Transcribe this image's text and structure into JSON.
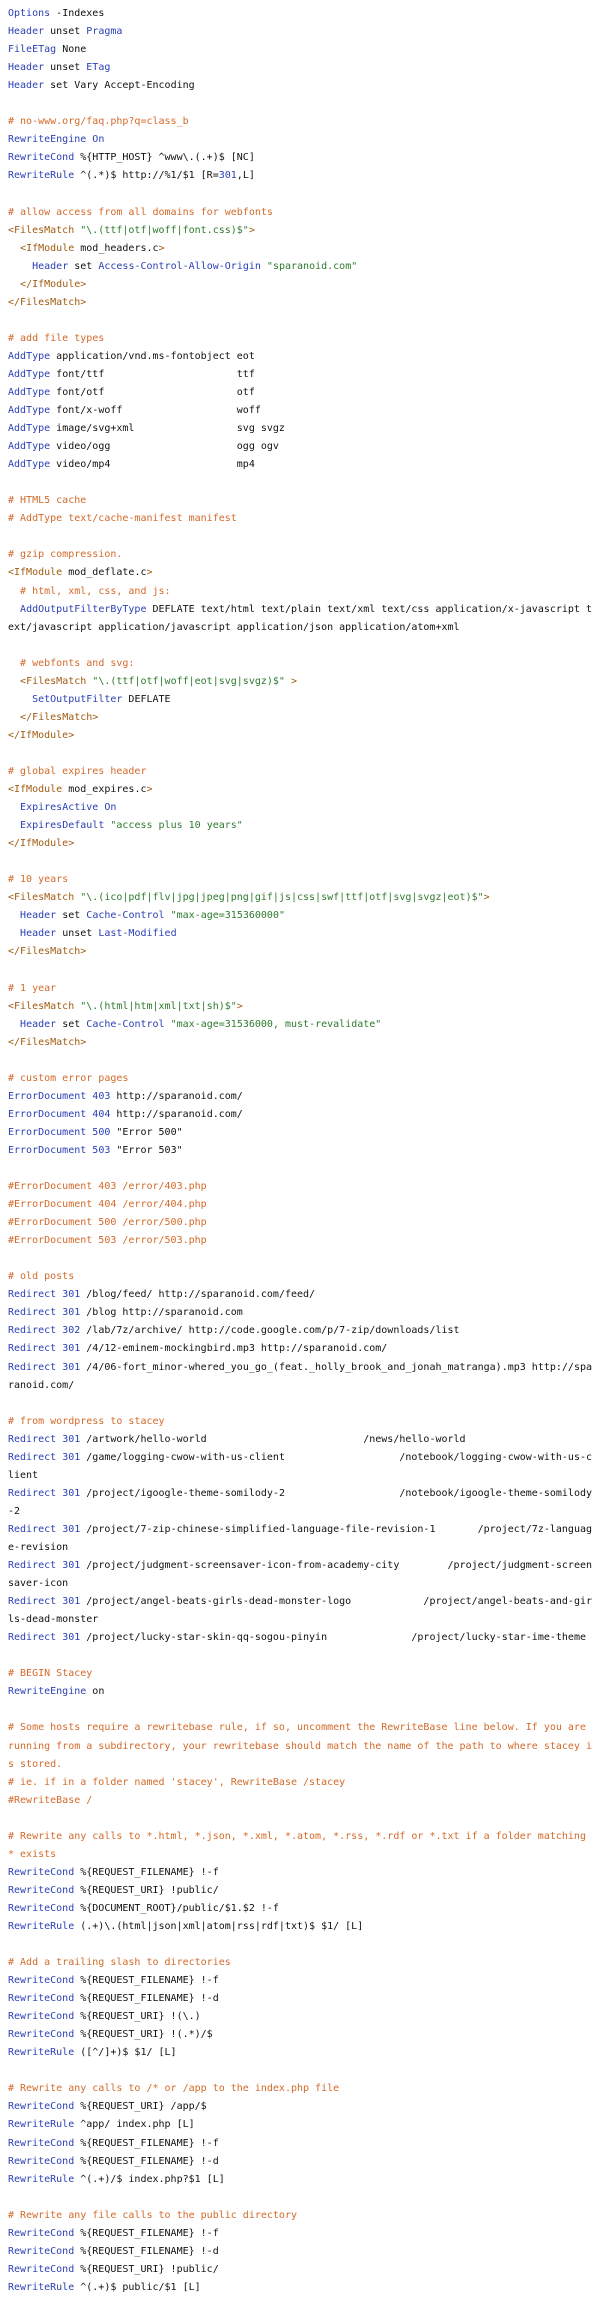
{
  "colors": {
    "background": "#ffffff",
    "text": "#111111",
    "directive": "#2b3fb5",
    "comment": "#d36a2a",
    "string": "#2f7a2f",
    "tag": "#a05a10"
  },
  "lines": [
    [
      [
        "kw",
        "Options "
      ],
      [
        "tx",
        "-Indexes"
      ]
    ],
    [
      [
        "kw",
        "Header "
      ],
      [
        "tx",
        "unset "
      ],
      [
        "kw",
        "Pragma"
      ]
    ],
    [
      [
        "kw",
        "FileETag "
      ],
      [
        "tx",
        "None"
      ]
    ],
    [
      [
        "kw",
        "Header "
      ],
      [
        "tx",
        "unset "
      ],
      [
        "kw",
        "ETag"
      ]
    ],
    [
      [
        "kw",
        "Header "
      ],
      [
        "tx",
        "set Vary Accept-Encoding"
      ]
    ],
    [],
    [
      [
        "cm",
        "# no-www.org/faq.php?q=class_b"
      ]
    ],
    [
      [
        "kw",
        "RewriteEngine "
      ],
      [
        "kw",
        "On"
      ]
    ],
    [
      [
        "kw",
        "RewriteCond "
      ],
      [
        "tx",
        "%{HTTP_HOST} ^www\\.(.+)$ [NC]"
      ]
    ],
    [
      [
        "kw",
        "RewriteRule "
      ],
      [
        "tx",
        "^(.*)$ http://%1/$1 [R="
      ],
      [
        "num",
        "301"
      ],
      [
        "tx",
        ",L]"
      ]
    ],
    [],
    [
      [
        "cm",
        "# allow access from all domains for webfonts"
      ]
    ],
    [
      [
        "tag",
        "<FilesMatch "
      ],
      [
        "str",
        "\"\\.(ttf|otf|woff|font.css)$\""
      ],
      [
        "tag",
        ">"
      ]
    ],
    [
      [
        "tx",
        "  "
      ],
      [
        "tag",
        "<IfModule "
      ],
      [
        "tx",
        "mod_headers.c"
      ],
      [
        "tag",
        ">"
      ]
    ],
    [
      [
        "tx",
        "    "
      ],
      [
        "kw",
        "Header "
      ],
      [
        "tx",
        "set "
      ],
      [
        "kw",
        "Access-Control-Allow-Origin "
      ],
      [
        "str",
        "\"sparanoid.com\""
      ]
    ],
    [
      [
        "tx",
        "  "
      ],
      [
        "tag",
        "</IfModule>"
      ]
    ],
    [
      [
        "tag",
        "</FilesMatch>"
      ]
    ],
    [],
    [
      [
        "cm",
        "# add file types"
      ]
    ],
    [
      [
        "kw",
        "AddType "
      ],
      [
        "tx",
        "application/vnd.ms-fontobject eot"
      ]
    ],
    [
      [
        "kw",
        "AddType "
      ],
      [
        "tx",
        "font/ttf                      ttf"
      ]
    ],
    [
      [
        "kw",
        "AddType "
      ],
      [
        "tx",
        "font/otf                      otf"
      ]
    ],
    [
      [
        "kw",
        "AddType "
      ],
      [
        "tx",
        "font/x-woff                   woff"
      ]
    ],
    [
      [
        "kw",
        "AddType "
      ],
      [
        "tx",
        "image/svg+xml                 svg svgz"
      ]
    ],
    [
      [
        "kw",
        "AddType "
      ],
      [
        "tx",
        "video/ogg                     ogg ogv"
      ]
    ],
    [
      [
        "kw",
        "AddType "
      ],
      [
        "tx",
        "video/mp4                     mp4"
      ]
    ],
    [],
    [
      [
        "cm",
        "# HTML5 cache"
      ]
    ],
    [
      [
        "cm",
        "# AddType text/cache-manifest manifest"
      ]
    ],
    [],
    [
      [
        "cm",
        "# gzip compression."
      ]
    ],
    [
      [
        "tag",
        "<IfModule "
      ],
      [
        "tx",
        "mod_deflate.c"
      ],
      [
        "tag",
        ">"
      ]
    ],
    [
      [
        "tx",
        "  "
      ],
      [
        "cm",
        "# html, xml, css, and js:"
      ]
    ],
    [
      [
        "tx",
        "  "
      ],
      [
        "kw",
        "AddOutputFilterByType "
      ],
      [
        "tx",
        "DEFLATE text/html text/plain text/xml text/css application/x-javascript text/javascript application/javascript application/json application/atom+xml"
      ]
    ],
    [],
    [
      [
        "tx",
        "  "
      ],
      [
        "cm",
        "# webfonts and svg:"
      ]
    ],
    [
      [
        "tx",
        "  "
      ],
      [
        "tag",
        "<FilesMatch "
      ],
      [
        "str",
        "\"\\.(ttf|otf|woff|eot|svg|svgz)$\" "
      ],
      [
        "tag",
        ">"
      ]
    ],
    [
      [
        "tx",
        "    "
      ],
      [
        "kw",
        "SetOutputFilter "
      ],
      [
        "tx",
        "DEFLATE"
      ]
    ],
    [
      [
        "tx",
        "  "
      ],
      [
        "tag",
        "</FilesMatch>"
      ]
    ],
    [
      [
        "tag",
        "</IfModule>"
      ]
    ],
    [],
    [
      [
        "cm",
        "# global expires header"
      ]
    ],
    [
      [
        "tag",
        "<IfModule "
      ],
      [
        "tx",
        "mod_expires.c"
      ],
      [
        "tag",
        ">"
      ]
    ],
    [
      [
        "tx",
        "  "
      ],
      [
        "kw",
        "ExpiresActive "
      ],
      [
        "kw",
        "On"
      ]
    ],
    [
      [
        "tx",
        "  "
      ],
      [
        "kw",
        "ExpiresDefault "
      ],
      [
        "str",
        "\"access plus 10 years\""
      ]
    ],
    [
      [
        "tag",
        "</IfModule>"
      ]
    ],
    [],
    [
      [
        "cm",
        "# 10 years"
      ]
    ],
    [
      [
        "tag",
        "<FilesMatch "
      ],
      [
        "str",
        "\"\\.(ico|pdf|flv|jpg|jpeg|png|gif|js|css|swf|ttf|otf|svg|svgz|eot)$\""
      ],
      [
        "tag",
        ">"
      ]
    ],
    [
      [
        "tx",
        "  "
      ],
      [
        "kw",
        "Header "
      ],
      [
        "tx",
        "set "
      ],
      [
        "kw",
        "Cache-Control "
      ],
      [
        "str",
        "\"max-age=315360000\""
      ]
    ],
    [
      [
        "tx",
        "  "
      ],
      [
        "kw",
        "Header "
      ],
      [
        "tx",
        "unset "
      ],
      [
        "kw",
        "Last-Modified"
      ]
    ],
    [
      [
        "tag",
        "</FilesMatch>"
      ]
    ],
    [],
    [
      [
        "cm",
        "# 1 year"
      ]
    ],
    [
      [
        "tag",
        "<FilesMatch "
      ],
      [
        "str",
        "\"\\.(html|htm|xml|txt|sh)$\""
      ],
      [
        "tag",
        ">"
      ]
    ],
    [
      [
        "tx",
        "  "
      ],
      [
        "kw",
        "Header "
      ],
      [
        "tx",
        "set "
      ],
      [
        "kw",
        "Cache-Control "
      ],
      [
        "str",
        "\"max-age=31536000, must-revalidate\""
      ]
    ],
    [
      [
        "tag",
        "</FilesMatch>"
      ]
    ],
    [],
    [
      [
        "cm",
        "# custom error pages"
      ]
    ],
    [
      [
        "kw",
        "ErrorDocument "
      ],
      [
        "num",
        "403 "
      ],
      [
        "tx",
        "http://sparanoid.com/"
      ]
    ],
    [
      [
        "kw",
        "ErrorDocument "
      ],
      [
        "num",
        "404 "
      ],
      [
        "tx",
        "http://sparanoid.com/"
      ]
    ],
    [
      [
        "kw",
        "ErrorDocument "
      ],
      [
        "num",
        "500 "
      ],
      [
        "tx",
        "\"Error 500\""
      ]
    ],
    [
      [
        "kw",
        "ErrorDocument "
      ],
      [
        "num",
        "503 "
      ],
      [
        "tx",
        "\"Error 503\""
      ]
    ],
    [],
    [
      [
        "cm",
        "#ErrorDocument 403 /error/403.php"
      ]
    ],
    [
      [
        "cm",
        "#ErrorDocument 404 /error/404.php"
      ]
    ],
    [
      [
        "cm",
        "#ErrorDocument 500 /error/500.php"
      ]
    ],
    [
      [
        "cm",
        "#ErrorDocument 503 /error/503.php"
      ]
    ],
    [],
    [
      [
        "cm",
        "# old posts"
      ]
    ],
    [
      [
        "kw",
        "Redirect "
      ],
      [
        "num",
        "301 "
      ],
      [
        "tx",
        "/blog/feed/ http://sparanoid.com/feed/"
      ]
    ],
    [
      [
        "kw",
        "Redirect "
      ],
      [
        "num",
        "301 "
      ],
      [
        "tx",
        "/blog http://sparanoid.com"
      ]
    ],
    [
      [
        "kw",
        "Redirect "
      ],
      [
        "num",
        "302 "
      ],
      [
        "tx",
        "/lab/7z/archive/ http://code.google.com/p/7-zip/downloads/list"
      ]
    ],
    [
      [
        "kw",
        "Redirect "
      ],
      [
        "num",
        "301 "
      ],
      [
        "tx",
        "/4/12-eminem-mockingbird.mp3 http://sparanoid.com/"
      ]
    ],
    [
      [
        "kw",
        "Redirect "
      ],
      [
        "num",
        "301 "
      ],
      [
        "tx",
        "/4/06-fort_minor-whered_you_go_(feat._holly_brook_and_jonah_matranga).mp3 http://sparanoid.com/"
      ]
    ],
    [],
    [
      [
        "cm",
        "# from wordpress to stacey"
      ]
    ],
    [
      [
        "kw",
        "Redirect "
      ],
      [
        "num",
        "301 "
      ],
      [
        "tx",
        "/artwork/hello-world                          /news/hello-world"
      ]
    ],
    [
      [
        "kw",
        "Redirect "
      ],
      [
        "num",
        "301 "
      ],
      [
        "tx",
        "/game/logging-cwow-with-us-client                   /notebook/logging-cwow-with-us-client"
      ]
    ],
    [
      [
        "kw",
        "Redirect "
      ],
      [
        "num",
        "301 "
      ],
      [
        "tx",
        "/project/igoogle-theme-somilody-2                   /notebook/igoogle-theme-somilody-2"
      ]
    ],
    [
      [
        "kw",
        "Redirect "
      ],
      [
        "num",
        "301 "
      ],
      [
        "tx",
        "/project/7-zip-chinese-simplified-language-file-revision-1       /project/7z-language-revision"
      ]
    ],
    [
      [
        "kw",
        "Redirect "
      ],
      [
        "num",
        "301 "
      ],
      [
        "tx",
        "/project/judgment-screensaver-icon-from-academy-city        /project/judgment-screensaver-icon"
      ]
    ],
    [
      [
        "kw",
        "Redirect "
      ],
      [
        "num",
        "301 "
      ],
      [
        "tx",
        "/project/angel-beats-girls-dead-monster-logo            /project/angel-beats-and-girls-dead-monster"
      ]
    ],
    [
      [
        "kw",
        "Redirect "
      ],
      [
        "num",
        "301 "
      ],
      [
        "tx",
        "/project/lucky-star-skin-qq-sogou-pinyin              /project/lucky-star-ime-theme"
      ]
    ],
    [],
    [
      [
        "cm",
        "# BEGIN Stacey"
      ]
    ],
    [
      [
        "kw",
        "RewriteEngine "
      ],
      [
        "tx",
        "on"
      ]
    ],
    [],
    [
      [
        "cm",
        "# Some hosts require a rewritebase rule, if so, uncomment the RewriteBase line below. If you are running from a subdirectory, your rewritebase should match the name of the path to where stacey is stored."
      ]
    ],
    [
      [
        "cm",
        "# ie. if in a folder named 'stacey', RewriteBase /stacey"
      ]
    ],
    [
      [
        "cm",
        "#RewriteBase /"
      ]
    ],
    [],
    [
      [
        "cm",
        "# Rewrite any calls to *.html, *.json, *.xml, *.atom, *.rss, *.rdf or *.txt if a folder matching * exists"
      ]
    ],
    [
      [
        "kw",
        "RewriteCond "
      ],
      [
        "tx",
        "%{REQUEST_FILENAME} !-f"
      ]
    ],
    [
      [
        "kw",
        "RewriteCond "
      ],
      [
        "tx",
        "%{REQUEST_URI} !public/"
      ]
    ],
    [
      [
        "kw",
        "RewriteCond "
      ],
      [
        "tx",
        "%{DOCUMENT_ROOT}/public/$1.$2 !-f"
      ]
    ],
    [
      [
        "kw",
        "RewriteRule "
      ],
      [
        "tx",
        "(.+)\\.(html|json|xml|atom|rss|rdf|txt)$ $1/ [L]"
      ]
    ],
    [],
    [
      [
        "cm",
        "# Add a trailing slash to directories"
      ]
    ],
    [
      [
        "kw",
        "RewriteCond "
      ],
      [
        "tx",
        "%{REQUEST_FILENAME} !-f"
      ]
    ],
    [
      [
        "kw",
        "RewriteCond "
      ],
      [
        "tx",
        "%{REQUEST_FILENAME} !-d"
      ]
    ],
    [
      [
        "kw",
        "RewriteCond "
      ],
      [
        "tx",
        "%{REQUEST_URI} !(\\.)"
      ]
    ],
    [
      [
        "kw",
        "RewriteCond "
      ],
      [
        "tx",
        "%{REQUEST_URI} !(.*)/$"
      ]
    ],
    [
      [
        "kw",
        "RewriteRule "
      ],
      [
        "tx",
        "([^/]+)$ $1/ [L]"
      ]
    ],
    [],
    [
      [
        "cm",
        "# Rewrite any calls to /* or /app to the index.php file"
      ]
    ],
    [
      [
        "kw",
        "RewriteCond "
      ],
      [
        "tx",
        "%{REQUEST_URI} /app/$"
      ]
    ],
    [
      [
        "kw",
        "RewriteRule "
      ],
      [
        "tx",
        "^app/ index.php [L]"
      ]
    ],
    [
      [
        "kw",
        "RewriteCond "
      ],
      [
        "tx",
        "%{REQUEST_FILENAME} !-f"
      ]
    ],
    [
      [
        "kw",
        "RewriteCond "
      ],
      [
        "tx",
        "%{REQUEST_FILENAME} !-d"
      ]
    ],
    [
      [
        "kw",
        "RewriteRule "
      ],
      [
        "tx",
        "^(.+)/$ index.php?$1 [L]"
      ]
    ],
    [],
    [
      [
        "cm",
        "# Rewrite any file calls to the public directory"
      ]
    ],
    [
      [
        "kw",
        "RewriteCond "
      ],
      [
        "tx",
        "%{REQUEST_FILENAME} !-f"
      ]
    ],
    [
      [
        "kw",
        "RewriteCond "
      ],
      [
        "tx",
        "%{REQUEST_FILENAME} !-d"
      ]
    ],
    [
      [
        "kw",
        "RewriteCond "
      ],
      [
        "tx",
        "%{REQUEST_URI} !public/"
      ]
    ],
    [
      [
        "kw",
        "RewriteRule "
      ],
      [
        "tx",
        "^(.+)$ public/$1 [L]"
      ]
    ]
  ]
}
